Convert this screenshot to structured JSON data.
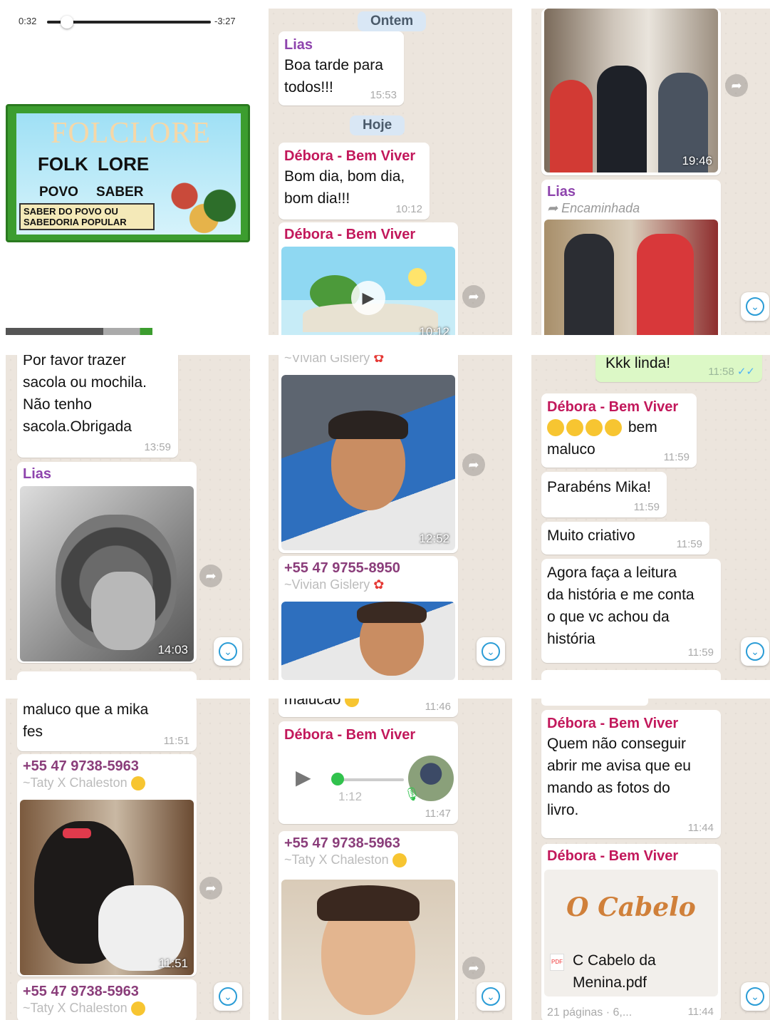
{
  "panel1": {
    "elapsed": "0:32",
    "remaining": "-3:27",
    "progress_fraction": 0.12,
    "banner": {
      "title": "FOLCLORE",
      "w1": "FOLK",
      "w2": "LORE",
      "w3": "POVO",
      "w4": "SABER",
      "line1": "SABER DO POVO OU",
      "line2": "SABEDORIA POPULAR"
    }
  },
  "panel2": {
    "date1": "Ontem",
    "m1_sender": "Lias",
    "m1_text": "Boa tarde para todos!!!",
    "m1_time": "15:53",
    "date2": "Hoje",
    "m2_sender": "Débora - Bem Viver",
    "m2_text": "Bom dia, bom dia, bom dia!!!",
    "m2_time": "10:12",
    "m3_sender": "Débora - Bem Viver",
    "m3_time": "10:12"
  },
  "panel3": {
    "img1_time": "19:46",
    "m2_sender": "Lias",
    "m2_forwarded": "Encaminhada"
  },
  "panel4": {
    "m1_text": "Por favor trazer\nsacola ou mochila.\nNão tenho\nsacola.Obrigada",
    "m1_time": "13:59",
    "m2_sender": "Lias",
    "m2_time": "14:03"
  },
  "panel5": {
    "top_sub": "~Vivian Gislery",
    "img1_time": "12:52",
    "m2_phone": "+55 47 9755-8950",
    "m2_sub": "~Vivian Gislery"
  },
  "panel6": {
    "out_text": "Kkk linda!",
    "out_time": "11:58",
    "m1_sender": "Débora - Bem Viver",
    "m1_text": "bem maluco",
    "m1_time": "11:59",
    "m2_text": "Parabéns Mika!",
    "m2_time": "11:59",
    "m3_text": "Muito criativo",
    "m3_time": "11:59",
    "m4_text": "Agora faça a leitura\nda história e me conta\no que vc achou da\nhistória",
    "m4_time": "11:59"
  },
  "panel7": {
    "m1_text": "maluco que a mika\nfes",
    "m1_time": "11:51",
    "m2_phone": "+55 47 9738-5963",
    "m2_sub": "~Taty X Chaleston",
    "img_time": "11:51",
    "m3_phone": "+55 47 9738-5963",
    "m3_sub": "~Taty X Chaleston"
  },
  "panel8": {
    "top_text": "malucão",
    "top_time": "11:46",
    "m1_sender": "Débora - Bem Viver",
    "audio_length": "1:12",
    "audio_progress": 0.05,
    "m1_time": "11:47",
    "m2_phone": "+55 47 9738-5963",
    "m2_sub": "~Taty X Chaleston"
  },
  "panel9": {
    "m1_sender": "Débora - Bem Viver",
    "m1_text": "Quem não conseguir\nabrir me avisa que eu\nmando as fotos do\nlivro.",
    "m1_time": "11:44",
    "m2_sender": "Débora - Bem Viver",
    "doc_art": "O Cabelo",
    "doc_name": "C Cabelo da\nMenina.pdf",
    "doc_meta": "21 páginas · 6,...",
    "m2_time": "11:44"
  },
  "colors": {
    "chat_bg": "#ece5dd",
    "outgoing": "#dcf8c6",
    "debora": "#c2185b",
    "lias": "#8e44ad",
    "accent": "#2a9cd6"
  }
}
